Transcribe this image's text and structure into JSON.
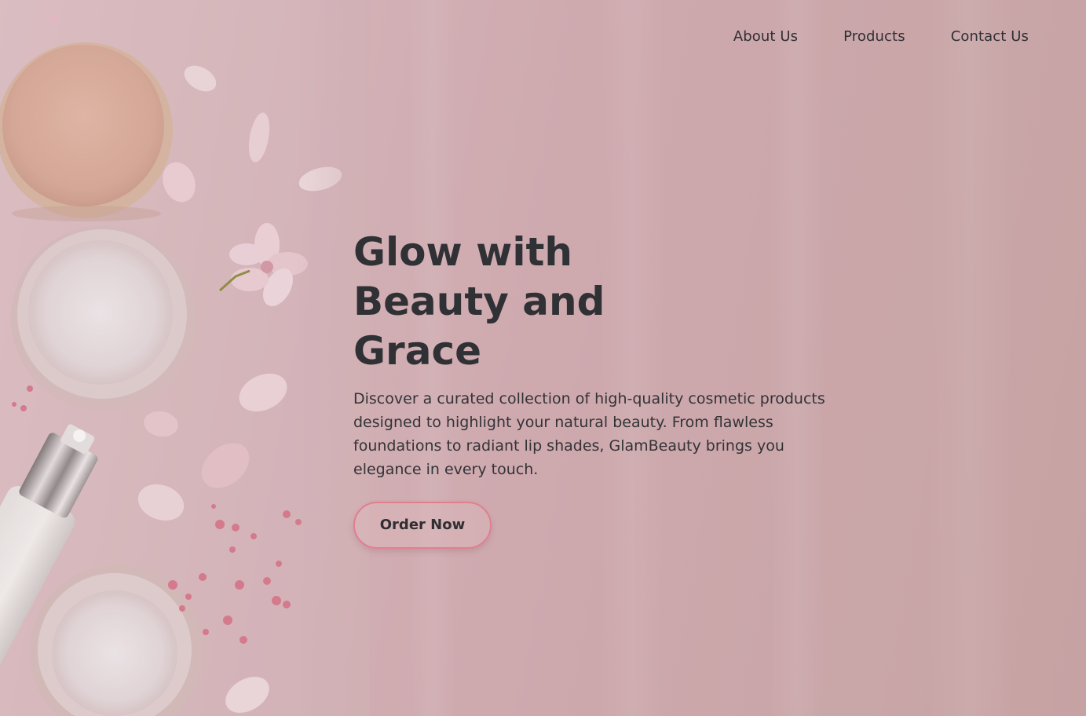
{
  "nav": {
    "items": [
      {
        "label": "About Us"
      },
      {
        "label": "Products"
      },
      {
        "label": "Contact Us"
      }
    ]
  },
  "hero": {
    "headline": "Glow with Beauty and Grace",
    "description": "Discover a curated collection of high-quality cosmetic products designed to highlight your natural beauty. From flawless foundations to radiant lip shades, GlamBeauty brings you elegance in every touch.",
    "cta_label": "Order Now"
  },
  "colors": {
    "background": "#cda8ad",
    "text": "#303135",
    "accent_border": "#e17f90"
  }
}
